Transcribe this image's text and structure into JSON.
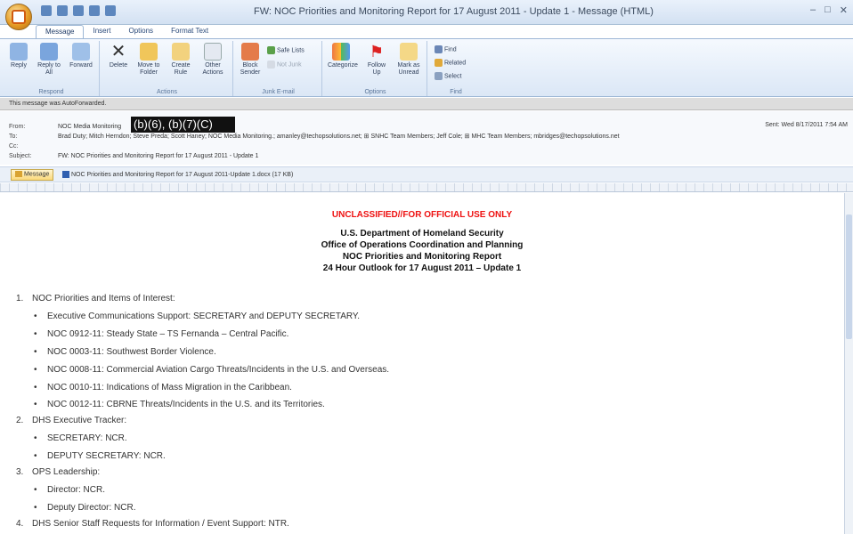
{
  "window": {
    "title": "FW: NOC Priorities and Monitoring Report for 17 August 2011 - Update 1 - Message (HTML)"
  },
  "ribbon": {
    "tabs": [
      "Message",
      "Insert",
      "Options",
      "Format Text"
    ],
    "groups": {
      "respond": {
        "label": "Respond",
        "buttons": [
          "Reply",
          "Reply to All",
          "Forward"
        ]
      },
      "actions": {
        "label": "Actions",
        "buttons": [
          "Delete",
          "Move to Folder",
          "Create Rule",
          "Other Actions"
        ]
      },
      "junk": {
        "label": "Junk E-mail",
        "buttons": [
          "Block Sender",
          "Safe Lists",
          "Not Junk"
        ]
      },
      "options": {
        "label": "Options",
        "buttons": [
          "Categorize",
          "Follow Up",
          "Mark as Unread"
        ]
      },
      "find": {
        "label": "Find",
        "buttons": [
          "Find",
          "Related",
          "Select"
        ]
      }
    }
  },
  "infobar": "This message was AutoForwarded.",
  "headers": {
    "from_label": "From:",
    "from": "NOC Media Monitoring",
    "to_label": "To:",
    "to": "Brad Duty; Mitch Herndon; Steve Preda; Scott Haney; NOC Media Monitoring.; amanley@techopsolutions.net; ⊞ SNHC Team Members; Jeff Cole; ⊞ MHC Team Members; mbridges@techopsolutions.net",
    "cc_label": "Cc:",
    "subject_label": "Subject:",
    "subject": "FW: NOC Priorities and Monitoring Report for 17 August 2011 - Update 1",
    "sent": "Sent:  Wed 8/17/2011 7:54 AM",
    "redaction": "(b)(6), (b)(7)(C)"
  },
  "attachments": {
    "message_button": "Message",
    "file": "NOC Priorities and Monitoring Report for 17 August 2011-Update 1.docx (17 KB)"
  },
  "document": {
    "classification": "UNCLASSIFIED//FOR OFFICIAL USE ONLY",
    "title_lines": [
      "U.S. Department of Homeland Security",
      "Office of Operations Coordination and Planning",
      "NOC Priorities and Monitoring Report",
      "24 Hour Outlook for 17 August 2011 – Update 1"
    ],
    "items": [
      {
        "num": "1.",
        "text": "NOC Priorities and Items of Interest:",
        "subs": [
          "Executive Communications Support:  SECRETARY and DEPUTY SECRETARY.",
          "NOC 0912-11:  Steady State – TS Fernanda – Central Pacific.",
          "NOC 0003-11:  Southwest Border Violence.",
          "NOC 0008-11:  Commercial Aviation Cargo Threats/Incidents in the U.S. and Overseas.",
          "NOC 0010-11:  Indications of Mass Migration in the Caribbean.",
          "NOC 0012-11:  CBRNE Threats/Incidents in the U.S. and its Territories."
        ]
      },
      {
        "num": "2.",
        "text": "DHS Executive Tracker:",
        "subs": [
          "SECRETARY:  NCR.",
          "DEPUTY SECRETARY:  NCR."
        ]
      },
      {
        "num": "3.",
        "text": "OPS Leadership:",
        "subs": [
          "Director:  NCR.",
          "Deputy Director:  NCR."
        ]
      },
      {
        "num": "4.",
        "text": "DHS Senior Staff Requests for Information / Event Support:  NTR.",
        "subs": []
      }
    ]
  }
}
